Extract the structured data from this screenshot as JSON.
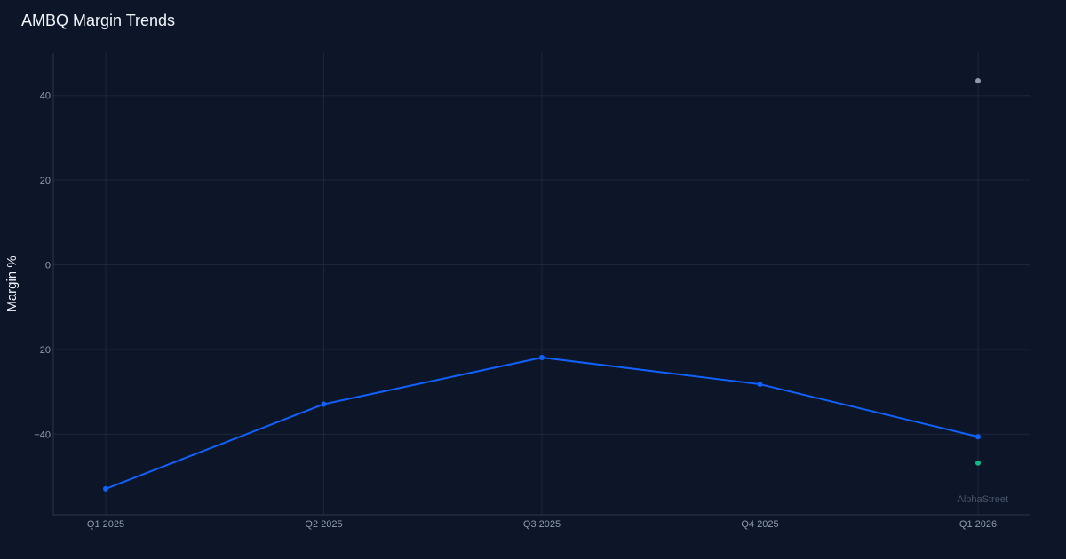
{
  "chart_data": {
    "type": "line",
    "title": "AMBQ Margin Trends",
    "ylabel": "Margin %",
    "xlabel": "",
    "categories": [
      "Q1 2025",
      "Q2 2025",
      "Q3 2025",
      "Q4 2025",
      "Q1 2026"
    ],
    "yticks": [
      40,
      20,
      0,
      -20,
      -40
    ],
    "ylim": [
      -59,
      50
    ],
    "grid": true,
    "series": [
      {
        "values": [
          -52.9,
          -32.9,
          -21.9,
          -28.2,
          -40.6
        ],
        "color": "#0f62fe",
        "style": "line"
      },
      {
        "values": [
          null,
          null,
          null,
          null,
          43.5
        ],
        "color": "#8d99ae",
        "style": "point"
      },
      {
        "values": [
          null,
          null,
          null,
          null,
          -46.8
        ],
        "color": "#10b981",
        "style": "point"
      }
    ],
    "watermark": "AlphaStreet"
  },
  "colors": {
    "background": "#0d1629",
    "grid": "#1c273a",
    "axis": "#2a3548"
  }
}
